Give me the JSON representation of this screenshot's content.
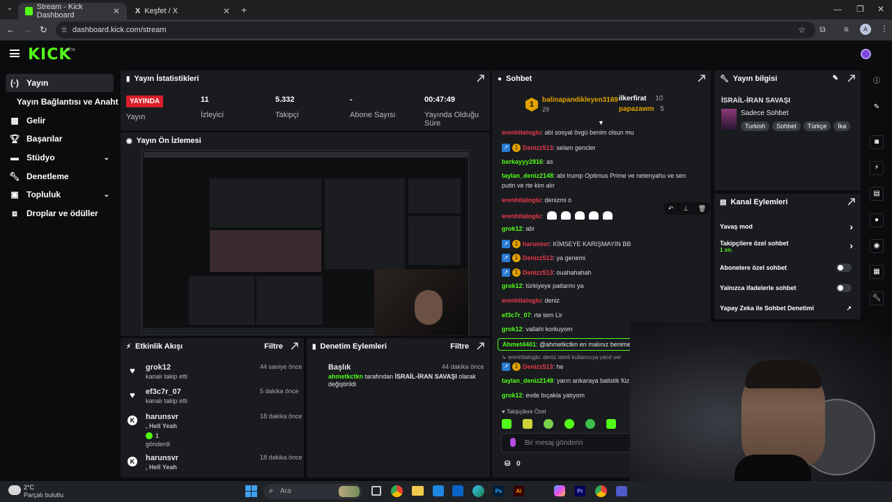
{
  "browser": {
    "tabs": [
      {
        "title": "Stream - Kick Dashboard"
      },
      {
        "title": "Keşfet / X"
      }
    ],
    "url": "dashboard.kick.com/stream",
    "profile_initial": "A"
  },
  "kick": {
    "logo": "KICK",
    "beta": "BETA"
  },
  "sidebar": {
    "items": [
      {
        "label": "Yayın",
        "icon": "broadcast-icon",
        "active": true
      },
      {
        "label": "Yayın Bağlantısı ve Anahtarı",
        "icon": ""
      },
      {
        "label": "Gelir",
        "icon": "revenue-icon"
      },
      {
        "label": "Başarılar",
        "icon": "trophy-icon"
      },
      {
        "label": "Stüdyo",
        "icon": "studio-icon",
        "has_chevron": true
      },
      {
        "label": "Denetleme",
        "icon": "wrench-icon"
      },
      {
        "label": "Topluluk",
        "icon": "community-icon",
        "has_chevron": true
      },
      {
        "label": "Droplar ve ödüller",
        "icon": "gift-icon"
      }
    ]
  },
  "stats": {
    "title": "Yayın İstatistikleri",
    "live_badge": "YAYINDA",
    "live_label": "Yayın",
    "items": [
      {
        "value": "11",
        "label": "İzleyici"
      },
      {
        "value": "5.332",
        "label": "Takipçi"
      },
      {
        "value": "-",
        "label": "Abone Sayısı"
      },
      {
        "value": "00:47:49",
        "label": "Yayında Olduğu Süre"
      }
    ]
  },
  "preview": {
    "title": "Yayın Ön İzlemesi"
  },
  "activity": {
    "title": "Etkinlik Akışı",
    "filter": "Filtre",
    "items": [
      {
        "name": "grok12",
        "time": "44 saniye önce",
        "sub": "kanalı takip etti",
        "icon": "heart-icon"
      },
      {
        "name": "ef3c7r_07",
        "time": "5 dakika önce",
        "sub": "kanalı takip etti",
        "icon": "heart-icon"
      },
      {
        "name": "harunsvr",
        "time": "18 dakika önce",
        "sub": ", Hell Yeah",
        "extra": "1",
        "extra2": "gönderdi",
        "icon": "kick-icon"
      },
      {
        "name": "harunsvr",
        "time": "18 dakika önce",
        "sub": ", Hell Yeah",
        "icon": "kick-icon"
      }
    ]
  },
  "moderation": {
    "title": "Denetim Eylemleri",
    "filter": "Filtre",
    "item": {
      "title": "Başlık",
      "time": "44 dakika önce",
      "actor": "ahmetkctkn",
      "text1": "tarafından",
      "target": "İSRAİL-İRAN SAVAŞI",
      "text2": "olarak",
      "text3": "değiştirildi"
    }
  },
  "chat": {
    "title": "Sohbet",
    "top": [
      {
        "rank": "1",
        "name": "balinapandikleyen3169",
        "count": "29"
      },
      {
        "name": "ilkerfirat",
        "count": "10"
      },
      {
        "name": "papazawm",
        "count": "5"
      }
    ],
    "messages": [
      {
        "user": "erenhitaloglu",
        "color": "#e83a4b",
        "text": ": abi sosyal övgü benim olsun mu"
      },
      {
        "user": "Denizz513",
        "color": "#e83a4b",
        "badges": true,
        "text": ": selam gencler"
      },
      {
        "user": "berkayyy2816",
        "color": "#53fc18",
        "text": ": as"
      },
      {
        "user": "taylan_deniz2148",
        "color": "#53fc18",
        "text": ": abi trump Optimus Prime ve netenyahu ve sen"
      },
      {
        "user": "",
        "color": "#ddd",
        "text": "putin ve rte kim alır"
      },
      {
        "user": "erenhitaloglu",
        "color": "#e83a4b",
        "text": ": denizmi o"
      },
      {
        "user": "erenhitaloglu",
        "color": "#e83a4b",
        "text": ":",
        "emotes": 5
      },
      {
        "user": "grok12",
        "color": "#53fc18",
        "text": ": abi"
      },
      {
        "user": "harunsvr",
        "color": "#e83a4b",
        "badges": true,
        "text": ": KİMSEYE KARIŞMAYIN BB"
      },
      {
        "user": "Denizz513",
        "color": "#e83a4b",
        "badges": true,
        "text": ": ya genemi"
      },
      {
        "user": "Denizz513",
        "color": "#e83a4b",
        "badges": true,
        "text": ": ouahahahah"
      },
      {
        "user": "grok12",
        "color": "#53fc18",
        "text": ": türkiyeye patlarmı ya"
      },
      {
        "user": "erenhitaloglu",
        "color": "#e83a4b",
        "text": ": deniz"
      },
      {
        "user": "ef3c7r_07",
        "color": "#53fc18",
        "text": ": rte tem Lir"
      },
      {
        "user": "grok12",
        "color": "#53fc18",
        "text": ": vallahi korkuyom"
      }
    ],
    "pinned": {
      "user": "Ahmet4401",
      "text": ": @ahmetkctkn en malınız benime"
    },
    "reply": "erenhitaloglu: deniz isimli kullanıcıya yanıt ver",
    "messages2": [
      {
        "user": "Denizz513",
        "color": "#e83a4b",
        "badges": true,
        "text": ": he"
      },
      {
        "user": "taylan_deniz2148",
        "color": "#53fc18",
        "text": ": yarın ankaraya balistik füz"
      },
      {
        "user": "grok12",
        "color": "#53fc18",
        "text": ": evde bıçakla yatıyom"
      }
    ],
    "followers_only": "Takipçilere Özel",
    "input_placeholder": "Bir mesaj gönderin",
    "points": "0"
  },
  "info": {
    "title": "Yayın bilgisi",
    "stream_title": "İSRAİL-İRAN SAVAŞI",
    "category": "Sadece Sohbet",
    "tags": [
      "Turkish",
      "Sohbet",
      "Türkçe",
      "İka"
    ]
  },
  "channel_actions": {
    "title": "Kanal Eylemleri",
    "items": [
      {
        "label": "Yavaş mod",
        "type": "chevron"
      },
      {
        "label": "Takipçilere özel sohbet",
        "sub": "1 sn.",
        "type": "chevron"
      },
      {
        "label": "Abonelere özel sohbet",
        "type": "toggle"
      },
      {
        "label": "Yalnızca ifadelerle sohbet",
        "type": "toggle"
      },
      {
        "label": "Yapay Zeka ile Sohbet Denetimi",
        "type": "link"
      }
    ]
  },
  "taskbar": {
    "temp": "2°C",
    "weather": "Parçalı bulutlu",
    "search": "Ara"
  },
  "colors": {
    "kick_green": "#53fc18",
    "live_red": "#d81e2a",
    "panel": "#191b1f"
  }
}
